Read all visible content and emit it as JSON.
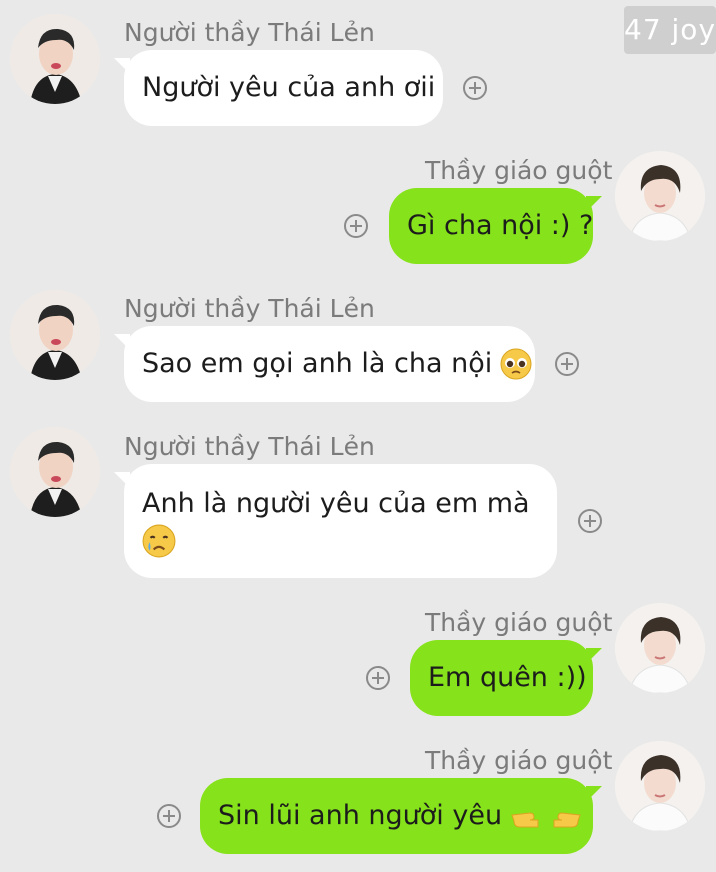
{
  "watermark": "47 joy",
  "contacts": {
    "left_name": "Người thầy Thái Lẻn",
    "right_name": "Thầy giáo guột"
  },
  "messages": [
    {
      "side": "in",
      "text": "Người yêu của anh ơii"
    },
    {
      "side": "out",
      "text": "Gì cha nội :) ?"
    },
    {
      "side": "in",
      "text": "Sao em gọi anh là cha nội",
      "emoji": "pleading-face-icon"
    },
    {
      "side": "in",
      "text": "Anh là người yêu của em mà",
      "emoji": "crying-face-icon"
    },
    {
      "side": "out",
      "text": "Em quên :))"
    },
    {
      "side": "out",
      "text": "Sin lũi anh người yêu",
      "emoji": "pointing-fingers-icon"
    }
  ],
  "colors": {
    "background": "#e9e9e9",
    "incoming_bubble": "#ffffff",
    "outgoing_bubble": "#86e21a",
    "sender_text": "#7b7b7b"
  }
}
